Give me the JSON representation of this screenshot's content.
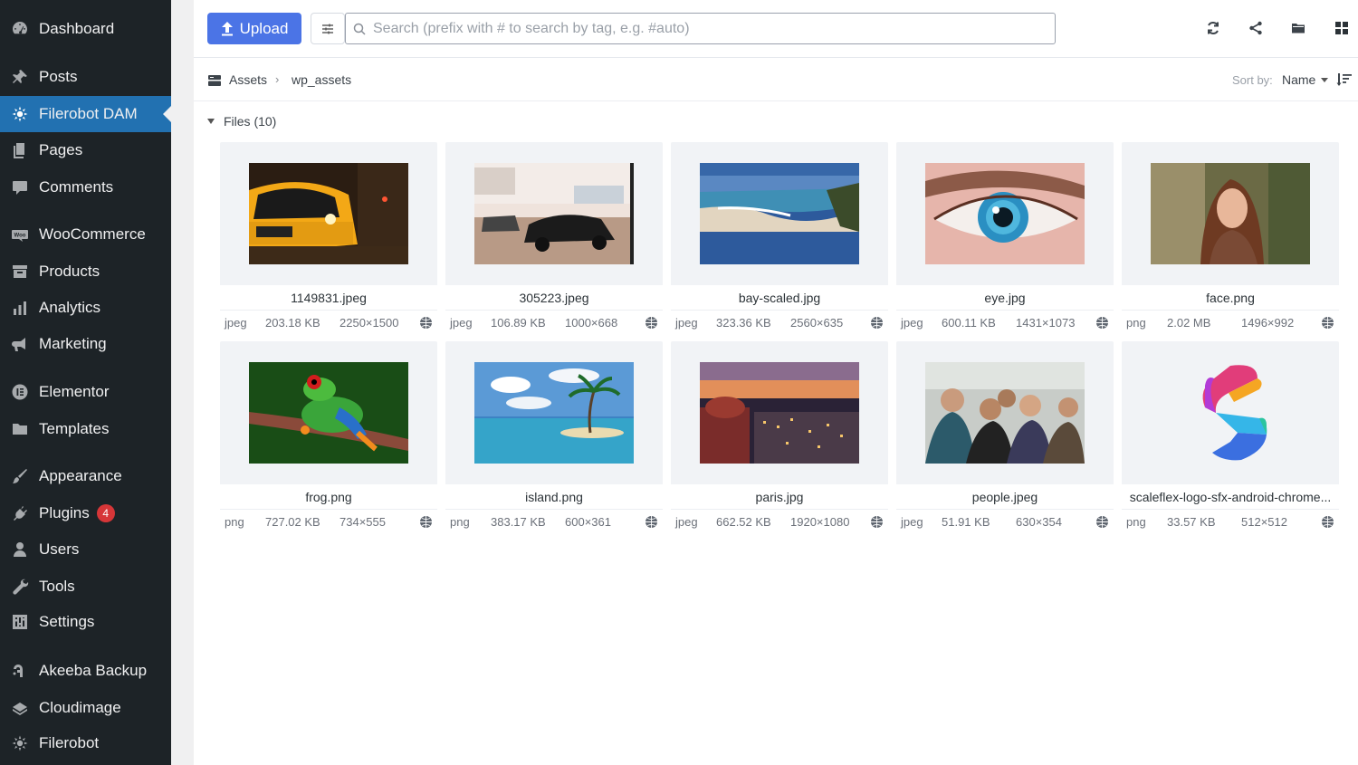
{
  "sidebar": {
    "items": [
      {
        "label": "Dashboard",
        "icon": "dashboard-icon"
      },
      {
        "label": "Posts",
        "icon": "pin-icon"
      },
      {
        "label": "Filerobot DAM",
        "icon": "filerobot-icon",
        "active": true
      },
      {
        "label": "Pages",
        "icon": "pages-icon"
      },
      {
        "label": "Comments",
        "icon": "comment-icon"
      },
      {
        "label": "WooCommerce",
        "icon": "woocommerce-icon"
      },
      {
        "label": "Products",
        "icon": "archive-icon"
      },
      {
        "label": "Analytics",
        "icon": "bar-chart-icon"
      },
      {
        "label": "Marketing",
        "icon": "megaphone-icon"
      },
      {
        "label": "Elementor",
        "icon": "elementor-icon"
      },
      {
        "label": "Templates",
        "icon": "folder-icon"
      },
      {
        "label": "Appearance",
        "icon": "brush-icon"
      },
      {
        "label": "Plugins",
        "icon": "plug-icon",
        "badge": "4"
      },
      {
        "label": "Users",
        "icon": "user-icon"
      },
      {
        "label": "Tools",
        "icon": "wrench-icon"
      },
      {
        "label": "Settings",
        "icon": "settings-icon"
      },
      {
        "label": "Akeeba Backup",
        "icon": "akeeba-icon"
      },
      {
        "label": "Cloudimage",
        "icon": "cloud-icon"
      },
      {
        "label": "Filerobot",
        "icon": "filerobot-icon"
      }
    ]
  },
  "toolbar": {
    "upload_label": "Upload",
    "search_placeholder": "Search (prefix with # to search by tag, e.g. #auto)",
    "search_value": ""
  },
  "breadcrumb": {
    "root": "Assets",
    "current": "wp_assets"
  },
  "sort": {
    "label": "Sort by:",
    "value": "Name"
  },
  "files": {
    "header": "Files (10)",
    "items": [
      {
        "name": "1149831.jpeg",
        "ext": "jpeg",
        "size": "203.18 KB",
        "dims": "2250×1500"
      },
      {
        "name": "305223.jpeg",
        "ext": "jpeg",
        "size": "106.89 KB",
        "dims": "1000×668"
      },
      {
        "name": "bay-scaled.jpg",
        "ext": "jpeg",
        "size": "323.36 KB",
        "dims": "2560×635"
      },
      {
        "name": "eye.jpg",
        "ext": "jpeg",
        "size": "600.11 KB",
        "dims": "1431×1073"
      },
      {
        "name": "face.png",
        "ext": "png",
        "size": "2.02 MB",
        "dims": "1496×992"
      },
      {
        "name": "frog.png",
        "ext": "png",
        "size": "727.02 KB",
        "dims": "734×555"
      },
      {
        "name": "island.png",
        "ext": "png",
        "size": "383.17 KB",
        "dims": "600×361"
      },
      {
        "name": "paris.jpg",
        "ext": "jpeg",
        "size": "662.52 KB",
        "dims": "1920×1080"
      },
      {
        "name": "people.jpeg",
        "ext": "jpeg",
        "size": "51.91 KB",
        "dims": "630×354"
      },
      {
        "name": "scaleflex-logo-sfx-android-chrome...",
        "ext": "png",
        "size": "33.57 KB",
        "dims": "512×512"
      }
    ]
  },
  "colors": {
    "sidebar_bg": "#1d2327",
    "active_item": "#2271b1",
    "upload_button": "#4b74e6",
    "badge": "#d63638"
  }
}
